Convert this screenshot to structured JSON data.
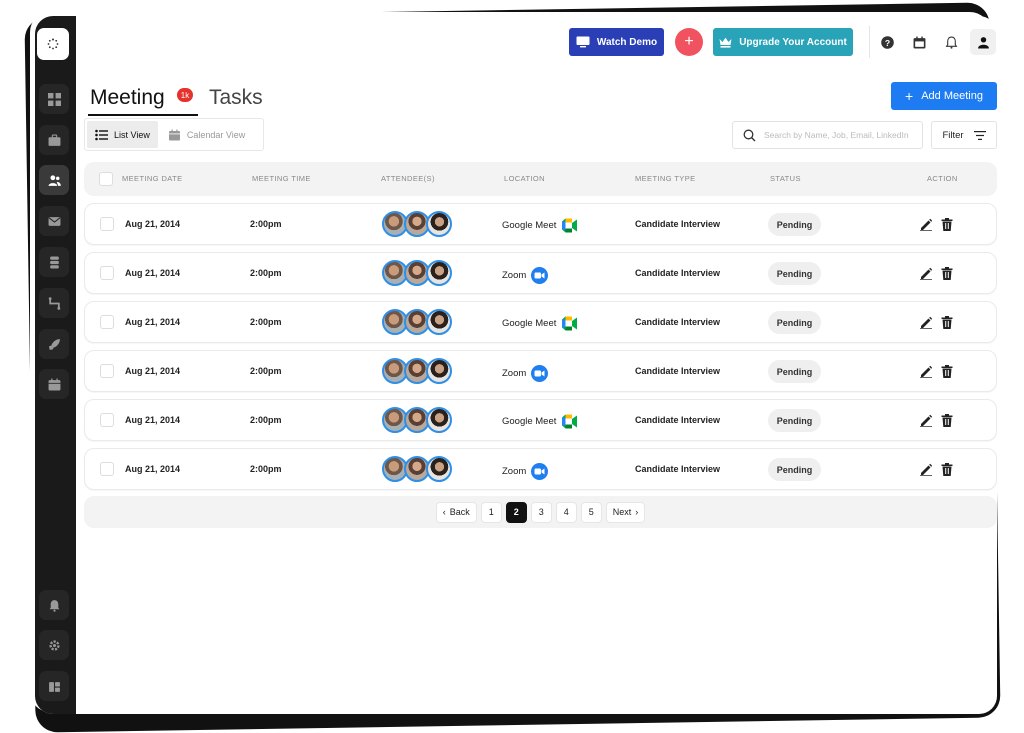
{
  "topbar": {
    "watch_demo": "Watch Demo",
    "upgrade": "Upgrade Your Account",
    "add_meeting": "Add Meeting"
  },
  "tabs": {
    "meeting": "Meeting",
    "meeting_badge": "1k",
    "tasks": "Tasks"
  },
  "views": {
    "list": "List View",
    "calendar": "Calendar View"
  },
  "search": {
    "placeholder": "Search by Name, Job, Email, LinkedIn"
  },
  "filter": {
    "label": "Filter"
  },
  "table": {
    "headers": [
      "MEETING DATE",
      "MEETING TIME",
      "ATTENDEE(S)",
      "LOCATION",
      "MEETING TYPE",
      "STATUS",
      "ACTION"
    ],
    "rows": [
      {
        "date": "Aug 21, 2014",
        "time": "2:00pm",
        "location": "Google Meet",
        "type": "Candidate Interview",
        "status": "Pending"
      },
      {
        "date": "Aug 21, 2014",
        "time": "2:00pm",
        "location": "Zoom",
        "type": "Candidate Interview",
        "status": "Pending"
      },
      {
        "date": "Aug 21, 2014",
        "time": "2:00pm",
        "location": "Google Meet",
        "type": "Candidate Interview",
        "status": "Pending"
      },
      {
        "date": "Aug 21, 2014",
        "time": "2:00pm",
        "location": "Zoom",
        "type": "Candidate Interview",
        "status": "Pending"
      },
      {
        "date": "Aug 21, 2014",
        "time": "2:00pm",
        "location": "Google Meet",
        "type": "Candidate Interview",
        "status": "Pending"
      },
      {
        "date": "Aug 21, 2014",
        "time": "2:00pm",
        "location": "Zoom",
        "type": "Candidate Interview",
        "status": "Pending"
      }
    ]
  },
  "pagination": {
    "back": "Back",
    "next": "Next",
    "pages": [
      "1",
      "2",
      "3",
      "4",
      "5"
    ],
    "current": "2"
  },
  "colors": {
    "sidebar": "#1a1a1a",
    "watch_demo": "#2a3fb5",
    "plus": "#f0535f",
    "upgrade": "#29a3b7",
    "add_meeting": "#1e7cf2",
    "badge": "#e5322d",
    "zoom": "#1f7ff0"
  },
  "icons": {
    "sidebar": [
      "logo-icon",
      "grid-icon",
      "briefcase-icon",
      "users-icon",
      "mail-icon",
      "database-icon",
      "flow-icon",
      "rocket-icon",
      "calendar-icon",
      "bell-icon",
      "gear-icon",
      "apps-icon"
    ],
    "top": [
      "help-icon",
      "calendar-icon",
      "bell-icon",
      "user-icon"
    ]
  }
}
